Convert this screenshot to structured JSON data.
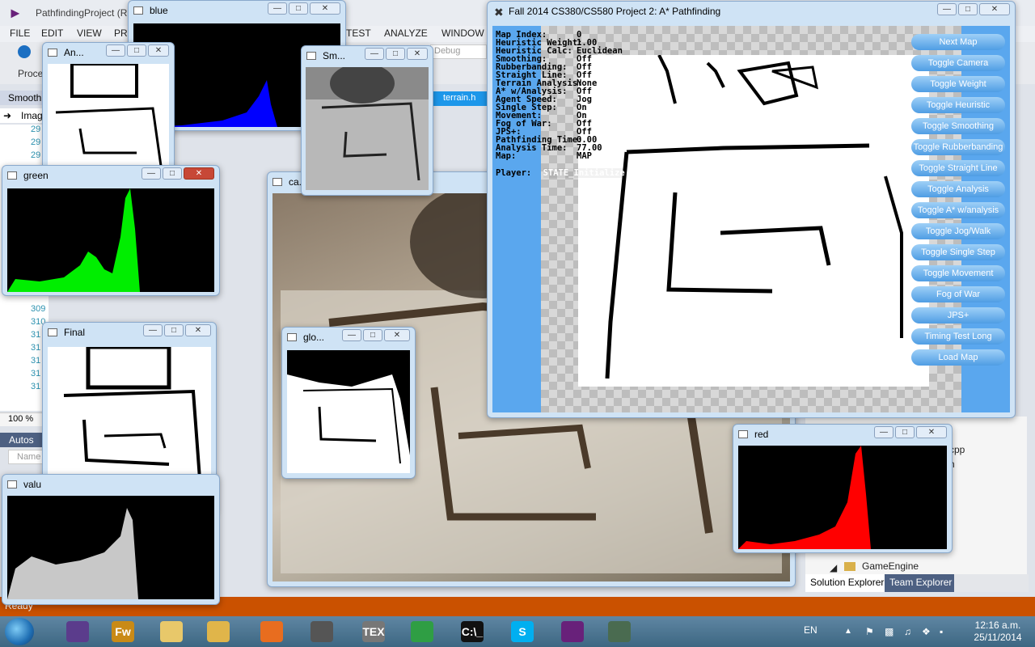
{
  "vs": {
    "title": "PathfindingProject (R",
    "menu": [
      "FILE",
      "EDIT",
      "VIEW",
      "PR",
      "TEST",
      "ANALYZE",
      "WINDOW"
    ],
    "config": "Debug",
    "process_label": "Proce",
    "left_tab": "Smooth",
    "image_item": "Imag",
    "line_numbers": [
      "29",
      "29",
      "29",
      "309",
      "310",
      "31",
      "31",
      "31",
      "31",
      "31"
    ],
    "zoom": "100 %",
    "autos_tab": "Autos",
    "name_header": "Name",
    "doc_tab": "terrain.h",
    "solution_nodes": [
      "GameEngine"
    ],
    "solution_partial": [
      "cpp",
      "h"
    ],
    "solution_tabs": [
      "Solution Explorer",
      "Team Explorer"
    ],
    "status": "Ready"
  },
  "windows": {
    "blue": {
      "title": "blue",
      "color": "#0000ff"
    },
    "analysis": {
      "title": "An..."
    },
    "smooth": {
      "title": "Sm..."
    },
    "green": {
      "title": "green",
      "color": "#00ee00"
    },
    "final": {
      "title": "Final"
    },
    "glob": {
      "title": "glo..."
    },
    "cam": {
      "title": "ca..."
    },
    "value": {
      "title": "valu",
      "color": "#c8c8c8"
    },
    "red": {
      "title": "red",
      "color": "#ff0000"
    }
  },
  "pathfinding": {
    "title": "Fall 2014 CS380/CS580 Project 2: A* Pathfinding",
    "info": [
      {
        "key": "Map Index:",
        "value": "0"
      },
      {
        "key": "Heuristic Weight:",
        "value": "1.00"
      },
      {
        "key": "Heuristic Calc:",
        "value": "Euclidean"
      },
      {
        "key": "Smoothing:",
        "value": "Off"
      },
      {
        "key": "Rubberbanding:",
        "value": "Off"
      },
      {
        "key": "Straight Line:",
        "value": "Off"
      },
      {
        "key": "Terrain Analysis:",
        "value": "None"
      },
      {
        "key": "A* w/Analysis:",
        "value": "Off"
      },
      {
        "key": "Agent Speed:",
        "value": "Jog"
      },
      {
        "key": "Single Step:",
        "value": "On"
      },
      {
        "key": "Movement:",
        "value": "On"
      },
      {
        "key": "Fog of War:",
        "value": "Off"
      },
      {
        "key": "JPS+:",
        "value": "Off"
      },
      {
        "key": "Pathfinding Time:",
        "value": "0.00"
      },
      {
        "key": "Analysis Time:",
        "value": "77.00"
      },
      {
        "key": "Map:",
        "value": "MAP"
      }
    ],
    "player_label": "Player:",
    "player_state": "STATE_Initialize",
    "buttons": [
      "Next Map",
      "Toggle Camera",
      "Toggle Weight",
      "Toggle Heuristic",
      "Toggle Smoothing",
      "Toggle Rubberbanding",
      "Toggle Straight Line",
      "Toggle Analysis",
      "Toggle A* w/analysis",
      "Toggle Jog/Walk",
      "Toggle Single Step",
      "Toggle Movement",
      "Fog of War",
      "JPS+",
      "Timing Test Long",
      "Load Map"
    ]
  },
  "taskbar": {
    "apps": [
      {
        "name": "eclipse",
        "glyph": "",
        "color": "#5b3c8c"
      },
      {
        "name": "fireworks",
        "glyph": "Fw",
        "color": "#c98a16"
      },
      {
        "name": "folders",
        "glyph": "",
        "color": "#e8c86a"
      },
      {
        "name": "explorer",
        "glyph": "",
        "color": "#e0b54a"
      },
      {
        "name": "firefox",
        "glyph": "",
        "color": "#e86d1f"
      },
      {
        "name": "installer",
        "glyph": "",
        "color": "#555"
      },
      {
        "name": "tex",
        "glyph": "TEX",
        "color": "#777"
      },
      {
        "name": "chrome",
        "glyph": "",
        "color": "#2f9e44"
      },
      {
        "name": "cmd",
        "glyph": "C:\\_",
        "color": "#111"
      },
      {
        "name": "skype",
        "glyph": "S",
        "color": "#00aff0"
      },
      {
        "name": "visualstudio",
        "glyph": "",
        "color": "#68217a"
      },
      {
        "name": "app-window",
        "glyph": "",
        "color": "#4a6b50"
      }
    ],
    "language": "EN",
    "time": "12:16 a.m.",
    "date": "25/11/2014"
  }
}
